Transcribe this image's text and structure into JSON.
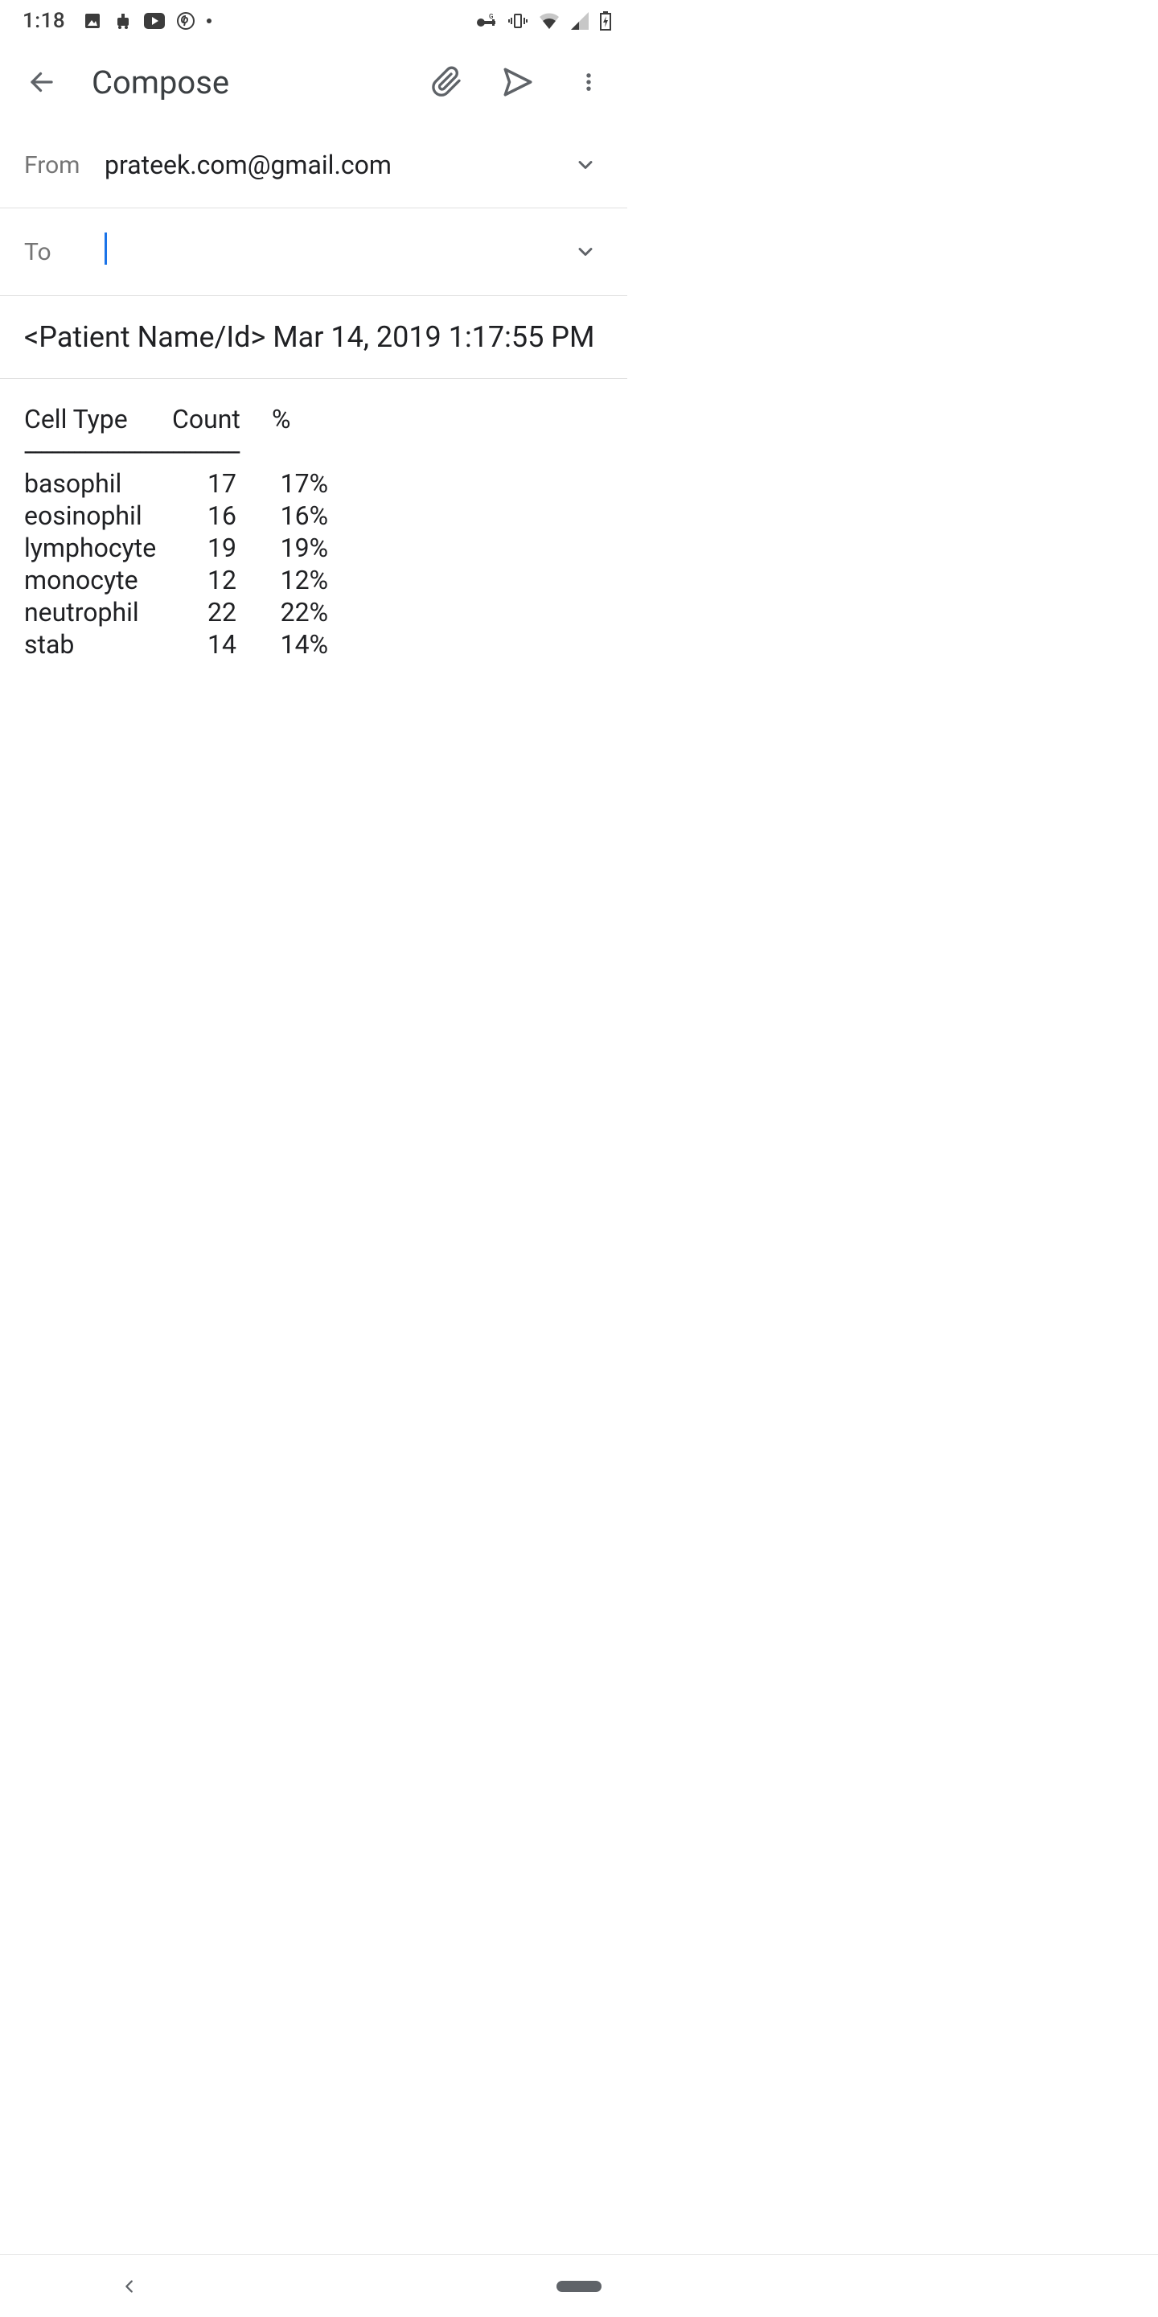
{
  "status_bar": {
    "time": "1:18"
  },
  "app_bar": {
    "title": "Compose"
  },
  "from": {
    "label": "From",
    "value": "prateek.com@gmail.com"
  },
  "to": {
    "label": "To",
    "value": ""
  },
  "subject": "<Patient Name/Id> Mar 14, 2019 1:17:55 PM",
  "body": {
    "headers": {
      "cell": "Cell Type",
      "count": "Count",
      "pct": "%"
    },
    "sep": "---------------------------------------",
    "rows": [
      {
        "cell": "basophil",
        "count": "17",
        "pct": "17%"
      },
      {
        "cell": "eosinophil",
        "count": "16",
        "pct": "16%"
      },
      {
        "cell": "lymphocyte",
        "count": "19",
        "pct": "19%"
      },
      {
        "cell": "monocyte",
        "count": "12",
        "pct": "12%"
      },
      {
        "cell": "neutrophil",
        "count": "22",
        "pct": "22%"
      },
      {
        "cell": "stab",
        "count": "14",
        "pct": "14%"
      }
    ]
  }
}
